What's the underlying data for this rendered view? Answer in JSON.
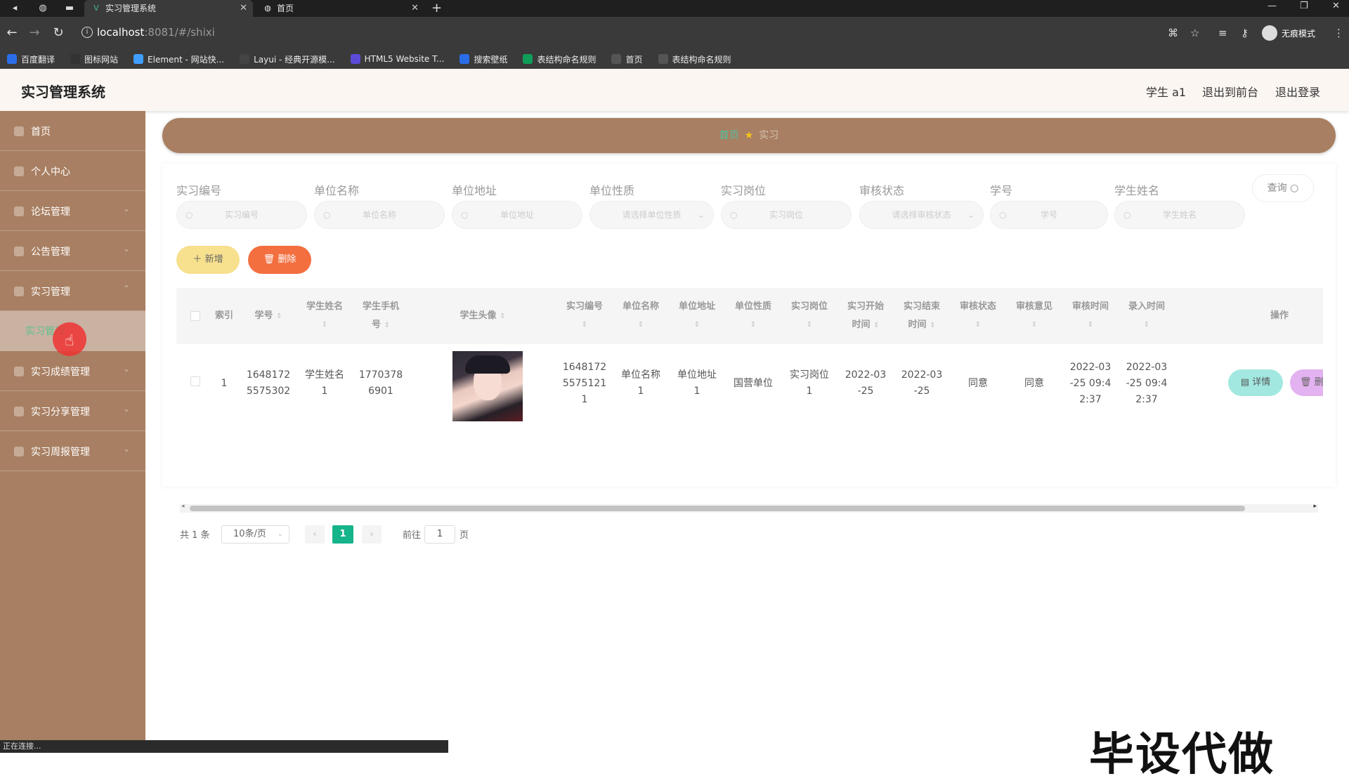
{
  "browser": {
    "tabs": [
      {
        "title": "实习管理系统",
        "icon": "vue-icon",
        "active": true
      },
      {
        "title": "首页",
        "icon": "globe-icon",
        "active": false
      }
    ],
    "new_tab": "+",
    "url_host": "localhost",
    "url_rest": ":8081/#/shixi",
    "profile_label": "无痕模式",
    "bookmarks": [
      {
        "label": "百度翻译",
        "color": "#2b6de8"
      },
      {
        "label": "图标网站",
        "color": "#333333"
      },
      {
        "label": "Element - 网站快...",
        "color": "#409eff"
      },
      {
        "label": "Layui - 经典开源模...",
        "color": "#444444"
      },
      {
        "label": "HTML5 Website T...",
        "color": "#5b4bd6"
      },
      {
        "label": "搜索壁纸",
        "color": "#2b6de8"
      },
      {
        "label": "表结构命名规则",
        "color": "#0f9d58"
      },
      {
        "label": "首页",
        "color": "#555555"
      },
      {
        "label": "表结构命名规则",
        "color": "#555555"
      }
    ]
  },
  "header": {
    "title": "实习管理系统",
    "user": "学生 a1",
    "to_front": "退出到前台",
    "logout": "退出登录"
  },
  "sidebar": {
    "items": [
      {
        "label": "首页"
      },
      {
        "label": "个人中心"
      },
      {
        "label": "论坛管理"
      },
      {
        "label": "公告管理"
      },
      {
        "label": "实习管理"
      },
      {
        "label": "实习成绩管理"
      },
      {
        "label": "实习分享管理"
      },
      {
        "label": "实习周报管理"
      }
    ],
    "active_sub": "实习管理"
  },
  "breadcrumb": {
    "home": "首页",
    "current": "实习"
  },
  "search": {
    "fields": [
      {
        "label": "实习编号",
        "placeholder": "实习编号"
      },
      {
        "label": "单位名称",
        "placeholder": "单位名称"
      },
      {
        "label": "单位地址",
        "placeholder": "单位地址"
      },
      {
        "label": "单位性质",
        "placeholder": "请选择单位性质"
      },
      {
        "label": "实习岗位",
        "placeholder": "实习岗位"
      },
      {
        "label": "审核状态",
        "placeholder": "请选择审核状态"
      },
      {
        "label": "学号",
        "placeholder": "学号"
      },
      {
        "label": "学生姓名",
        "placeholder": "学生姓名"
      }
    ],
    "query_label": "查询"
  },
  "actions": {
    "add": "新增",
    "delete": "删除"
  },
  "table": {
    "headers": [
      "索引",
      "学号",
      "学生姓名",
      "学生手机号",
      "学生头像",
      "实习编号",
      "单位名称",
      "单位地址",
      "单位性质",
      "实习岗位",
      "实习开始时间",
      "实习结束时间",
      "审核状态",
      "审核意见",
      "审核时间",
      "录入时间",
      "操作"
    ],
    "rows": [
      {
        "index": "1",
        "student_no": "1648172\n5575302",
        "student_name": "学生姓名\n1",
        "phone": "1770378\n6901",
        "intern_no": "1648172\n5575121\n1",
        "company": "单位名称\n1",
        "address": "单位地址\n1",
        "nature": "国营单位",
        "post": "实习岗位\n1",
        "start": "2022-03\n-25",
        "end": "2022-03\n-25",
        "status": "同意",
        "opinion": "同意",
        "review_time": "2022-03\n-25 09:4\n2:37",
        "entry_time": "2022-03\n-25 09:4\n2:37",
        "detail": "详情",
        "delete": "删"
      }
    ]
  },
  "pager": {
    "total": "共 1 条",
    "page_size": "10条/页",
    "current": "1",
    "goto_prefix": "前往",
    "goto_value": "1",
    "goto_suffix": "页"
  },
  "watermark": "毕设代做",
  "status_text": "正在连接..."
}
